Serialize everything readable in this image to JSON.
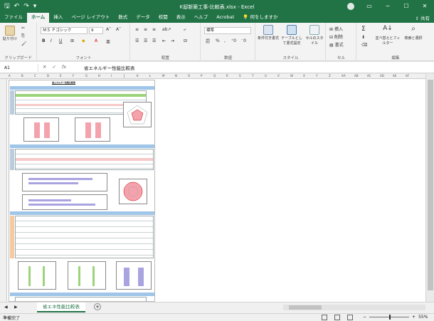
{
  "window": {
    "title": "K邸新築工事-比較表.xlsx - Excel",
    "search_placeholder": "何をしますか"
  },
  "quick_access": {
    "save": "🖫",
    "undo": "↶",
    "redo": "↷",
    "more": "▾"
  },
  "tabs": [
    {
      "label": "ファイル"
    },
    {
      "label": "ホーム",
      "active": true
    },
    {
      "label": "挿入"
    },
    {
      "label": "ページ レイアウト"
    },
    {
      "label": "数式"
    },
    {
      "label": "データ"
    },
    {
      "label": "校閲"
    },
    {
      "label": "表示"
    },
    {
      "label": "ヘルプ"
    },
    {
      "label": "Acrobat"
    }
  ],
  "share": "共有",
  "ribbon": {
    "clipboard": {
      "label": "クリップボード",
      "paste": "貼り付け"
    },
    "font": {
      "label": "フォント",
      "name": "ＭＳ Ｐゴシック",
      "size": "9",
      "bold": "B",
      "italic": "I",
      "underline": "U"
    },
    "alignment": {
      "label": "配置"
    },
    "number": {
      "label": "数値",
      "format": "標準",
      "percent": "%"
    },
    "styles": {
      "label": "スタイル",
      "conditional": "条件付き書式",
      "table": "テーブルとして書式設定",
      "cell": "セルのスタイル"
    },
    "cells": {
      "label": "セル",
      "insert": "挿入",
      "delete": "削除",
      "format": "書式"
    },
    "editing": {
      "label": "編集",
      "sort": "並べ替えとフィルター",
      "find": "検索と選択"
    }
  },
  "formula_bar": {
    "name_box": "A1",
    "fx": "fx",
    "value": "省エネルギー性能比較表"
  },
  "sheet": {
    "preview_title": "省エネルギー性能比較表",
    "column_letters": [
      "A",
      "B",
      "C",
      "D",
      "E",
      "F",
      "G",
      "H",
      "I",
      "J",
      "K",
      "L",
      "M",
      "N",
      "O",
      "P",
      "Q",
      "R",
      "S",
      "T",
      "U",
      "V",
      "W",
      "X",
      "Y",
      "Z",
      "AA",
      "AB",
      "AC",
      "AD",
      "AE",
      "AF"
    ]
  },
  "sheet_tabs": [
    {
      "label": "省エネ性能比較表",
      "active": true
    }
  ],
  "status": {
    "ready": "準備完了",
    "zoom": "55%"
  },
  "colors": {
    "accent": "#217346",
    "pink": "#f4a3ad",
    "green": "#9cd47a",
    "lilac": "#a9a4e0",
    "section": "#9fc5e8"
  }
}
